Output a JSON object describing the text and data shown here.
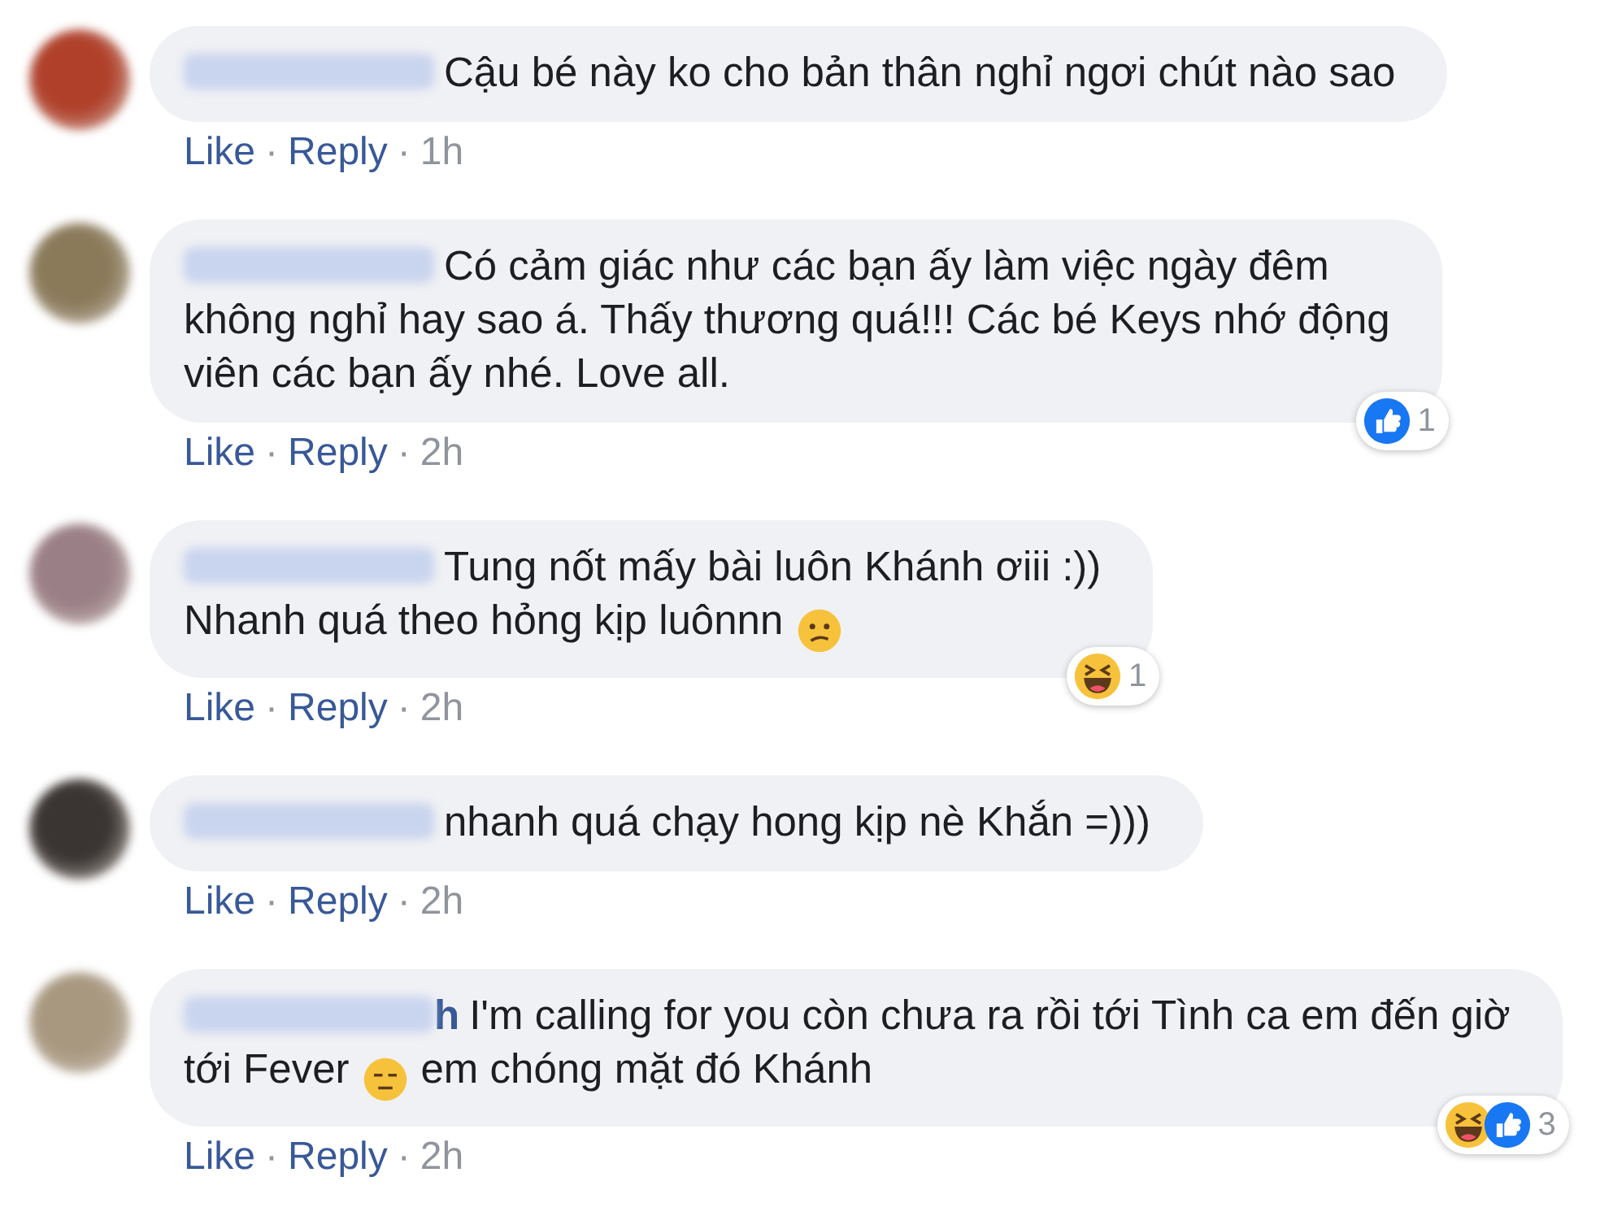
{
  "comments": [
    {
      "segments": [
        {
          "kind": "text",
          "text": "Cậu bé này ko cho bản thân nghỉ ngơi chút nào sao"
        }
      ],
      "actions": [
        "Like",
        "Reply"
      ],
      "separator": "·",
      "time": "1h"
    },
    {
      "segments": [
        {
          "kind": "text",
          "text": "Có cảm giác như các bạn ấy làm việc ngày đêm"
        },
        {
          "kind": "break"
        },
        {
          "kind": "text",
          "text": "không nghỉ hay sao á. Thấy thương quá!!! Các bé Keys nhớ động"
        },
        {
          "kind": "break"
        },
        {
          "kind": "text",
          "text": "viên các bạn ấy nhé. Love all."
        }
      ],
      "actions": [
        "Like",
        "Reply"
      ],
      "separator": "·",
      "time": "2h",
      "reactions": [
        {
          "kind": "like"
        }
      ],
      "reaction_count": "1"
    },
    {
      "segments": [
        {
          "kind": "text",
          "text": "Tung nốt mấy bài luôn Khánh ơiii :))"
        },
        {
          "kind": "break"
        },
        {
          "kind": "text",
          "text": "Nhanh quá theo hỏng kịp luônnn"
        },
        {
          "kind": "confused"
        }
      ],
      "actions": [
        "Like",
        "Reply"
      ],
      "separator": "·",
      "time": "2h",
      "reactions": [
        {
          "kind": "haha"
        }
      ],
      "reaction_count": "1"
    },
    {
      "segments": [
        {
          "kind": "text",
          "text": "nhanh quá chạy hong kịp nè Khắn =)))"
        }
      ],
      "actions": [
        "Like",
        "Reply"
      ],
      "separator": "·",
      "time": "2h"
    },
    {
      "name_tail": "h",
      "segments": [
        {
          "kind": "text",
          "text": "I'm calling for you còn chưa ra rồi tới Tình ca em đến giờ"
        },
        {
          "kind": "break"
        },
        {
          "kind": "text",
          "text": "tới Fever"
        },
        {
          "kind": "expressionless"
        },
        {
          "kind": "text",
          "text": "em chóng mặt đó Khánh"
        }
      ],
      "actions": [
        "Like",
        "Reply"
      ],
      "separator": "·",
      "time": "2h",
      "reactions": [
        {
          "kind": "haha"
        },
        {
          "kind": "like"
        }
      ],
      "reaction_count": "3"
    }
  ]
}
